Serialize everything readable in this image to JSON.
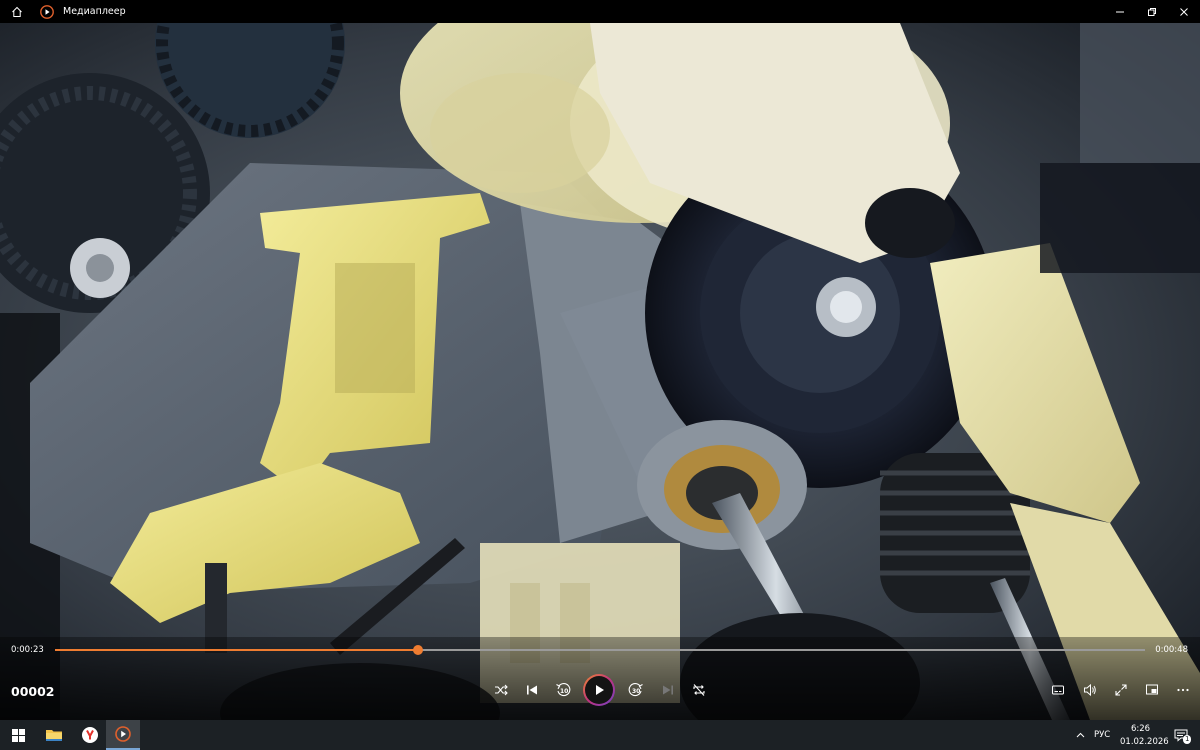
{
  "window": {
    "title": "Медиаплеер",
    "icons": [
      "home-icon",
      "media-player-app-icon",
      "minimize-icon",
      "restore-icon",
      "close-icon"
    ]
  },
  "player": {
    "current_time": "0:00:23",
    "duration": "0:00:48",
    "progress_fraction": 0.333,
    "media_title": "00002",
    "accent_color": "#ef7d31",
    "skip_back_seconds": "10",
    "skip_forward_seconds": "30",
    "buttons": [
      "shuffle",
      "previous",
      "skip-back-10",
      "play",
      "skip-forward-30",
      "next",
      "repeat",
      "subtitles",
      "volume",
      "fullscreen",
      "mini-player",
      "more-options"
    ]
  },
  "taskbar": {
    "lang": "РУС",
    "clock_time": "6:26",
    "clock_date": "01.02.2026",
    "notification_count": "1",
    "pinned": [
      "start-icon",
      "file-explorer-icon",
      "yandex-browser-icon",
      "media-player-icon"
    ]
  }
}
